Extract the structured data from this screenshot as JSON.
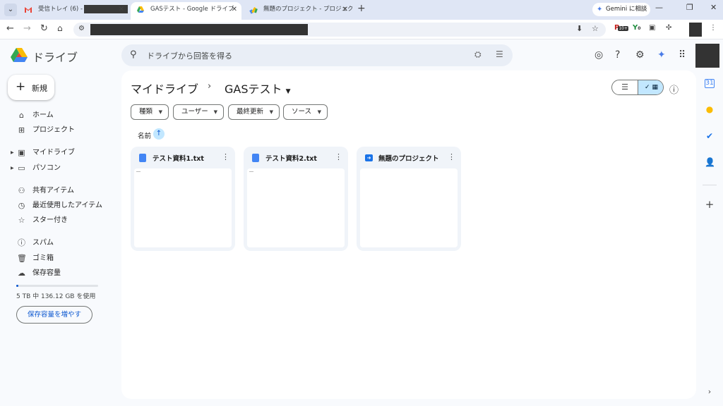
{
  "browser": {
    "tab_menu_icon": "chevron-down-icon",
    "tabs": [
      {
        "title": "受信トレイ (6) -",
        "active": false,
        "favicon": "gmail-icon"
      },
      {
        "title": "GASテスト - Google ドライブ",
        "active": true,
        "favicon": "drive-icon"
      },
      {
        "title": "無題のプロジェクト - プロジェクト編集",
        "active": false,
        "favicon": "apps-script-icon"
      }
    ],
    "gemini_label": "Gemini に相談",
    "extension_badge": "10+",
    "extension_badge2": "0"
  },
  "drive": {
    "brand": "ドライブ",
    "search_placeholder": "ドライブから回答を得る",
    "new_label": "新規",
    "sidebar": [
      {
        "label": "ホーム",
        "icon": "home-icon"
      },
      {
        "label": "プロジェクト",
        "icon": "projects-icon"
      },
      {
        "label": "マイドライブ",
        "icon": "my-drive-icon"
      },
      {
        "label": "パソコン",
        "icon": "computers-icon"
      },
      {
        "label": "共有アイテム",
        "icon": "shared-icon"
      },
      {
        "label": "最近使用したアイテム",
        "icon": "clock-icon"
      },
      {
        "label": "スター付き",
        "icon": "star-icon"
      },
      {
        "label": "スパム",
        "icon": "spam-icon"
      },
      {
        "label": "ゴミ箱",
        "icon": "trash-icon"
      },
      {
        "label": "保存容量",
        "icon": "cloud-icon"
      }
    ],
    "storage_text": "5 TB 中 136.12 GB を使用",
    "storage_fraction": 0.027,
    "more_storage_label": "保存容量を増やす",
    "breadcrumb": [
      "マイドライブ",
      "GASテスト"
    ],
    "filters": [
      "種類",
      "ユーザー",
      "最終更新",
      "ソース"
    ],
    "sort_label": "名前",
    "files": [
      {
        "name": "テスト資料1.txt",
        "type": "doc",
        "color": "#4285f4"
      },
      {
        "name": "テスト資料2.txt",
        "type": "doc",
        "color": "#4285f4"
      },
      {
        "name": "無題のプロジェクト",
        "type": "script",
        "color": "#1a73e8"
      }
    ],
    "colors": {
      "accent": "#0b57d0",
      "selected": "#c2e7ff"
    }
  }
}
